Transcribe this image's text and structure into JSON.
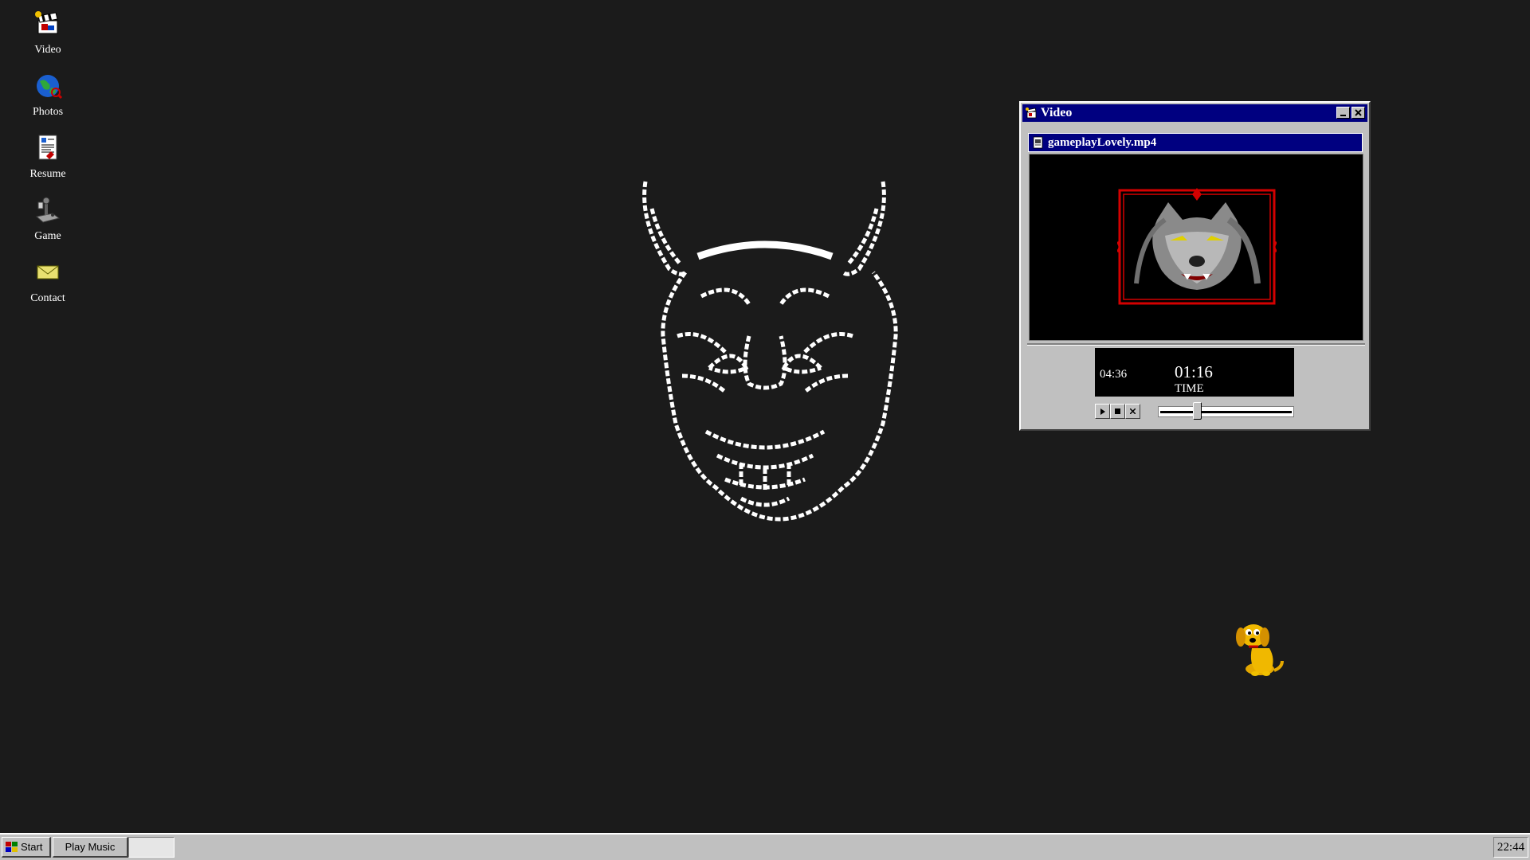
{
  "desktop": {
    "icons": [
      {
        "label": "Video",
        "icon": "video-clapper-icon"
      },
      {
        "label": "Photos",
        "icon": "globe-icon"
      },
      {
        "label": "Resume",
        "icon": "document-icon"
      },
      {
        "label": "Game",
        "icon": "joystick-icon"
      },
      {
        "label": "Contact",
        "icon": "envelope-icon"
      }
    ]
  },
  "window": {
    "title": "Video",
    "file_name": "gameplayLovely.mp4",
    "player": {
      "duration": "04:36",
      "current_time": "01:16",
      "time_label": "TIME",
      "seek_fraction": 0.276
    }
  },
  "taskbar": {
    "start_label": "Start",
    "task_label": "Play Music",
    "clock": "22:44"
  },
  "colors": {
    "desktop_bg": "#1b1b1b",
    "titlebar": "#000080",
    "chrome": "#c0c0c0",
    "frame_red": "#d40000"
  }
}
